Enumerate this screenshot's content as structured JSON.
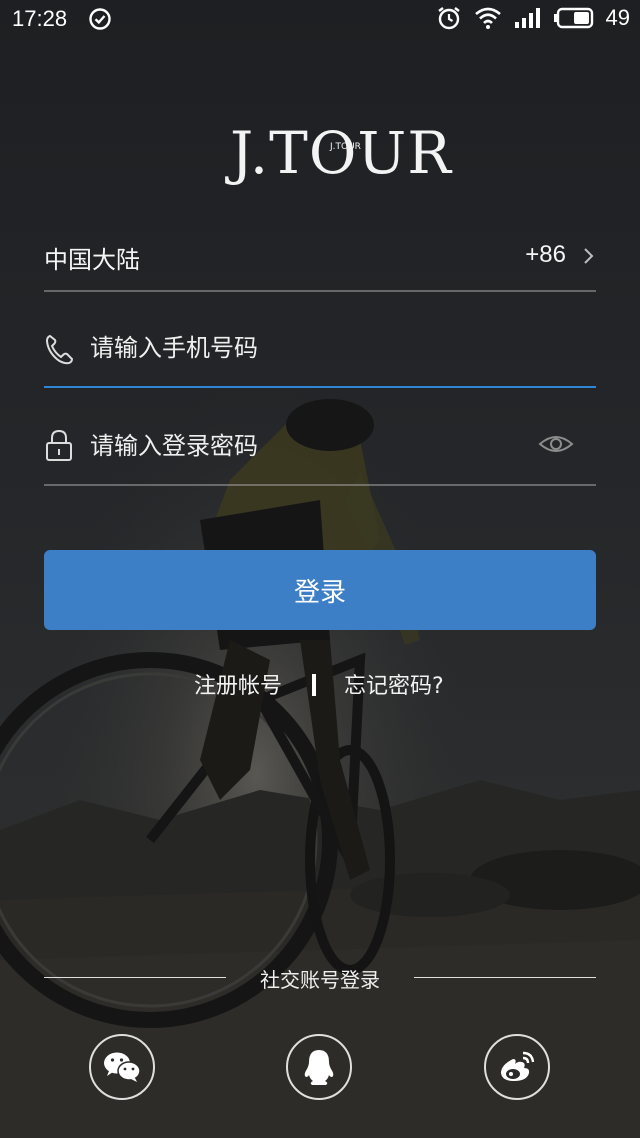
{
  "status_bar": {
    "time": "17:28",
    "battery_percent": "49"
  },
  "logo": {
    "text": "J.TOUR",
    "sub_text": "J.TOUR"
  },
  "form": {
    "region_name": "中国大陆",
    "region_code": "+86",
    "phone_placeholder": "请输入手机号码",
    "password_placeholder": "请输入登录密码",
    "login_label": "登录"
  },
  "links": {
    "register": "注册帐号",
    "forgot": "忘记密码?"
  },
  "social": {
    "title": "社交账号登录",
    "providers": [
      "wechat-icon",
      "qq-icon",
      "weibo-icon"
    ]
  },
  "colors": {
    "accent": "#3c7fc6",
    "active_underline": "#2f86d6"
  }
}
